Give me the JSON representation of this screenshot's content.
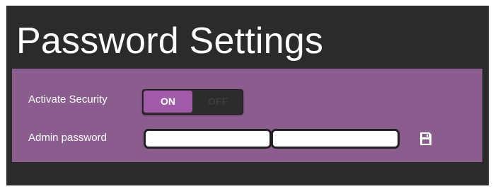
{
  "page": {
    "title": "Password Settings"
  },
  "security": {
    "label": "Activate Security",
    "toggle": {
      "on_label": "ON",
      "off_label": "OFF",
      "state": "on"
    }
  },
  "password": {
    "label": "Admin password",
    "field1": {
      "value": "",
      "placeholder": ""
    },
    "field2": {
      "value": "",
      "placeholder": ""
    },
    "save_icon": "save-icon"
  },
  "colors": {
    "background": "#2b2b2b",
    "panel": "#8b5d8f",
    "toggle_active": "#a05aa8",
    "text": "#ffffff"
  }
}
